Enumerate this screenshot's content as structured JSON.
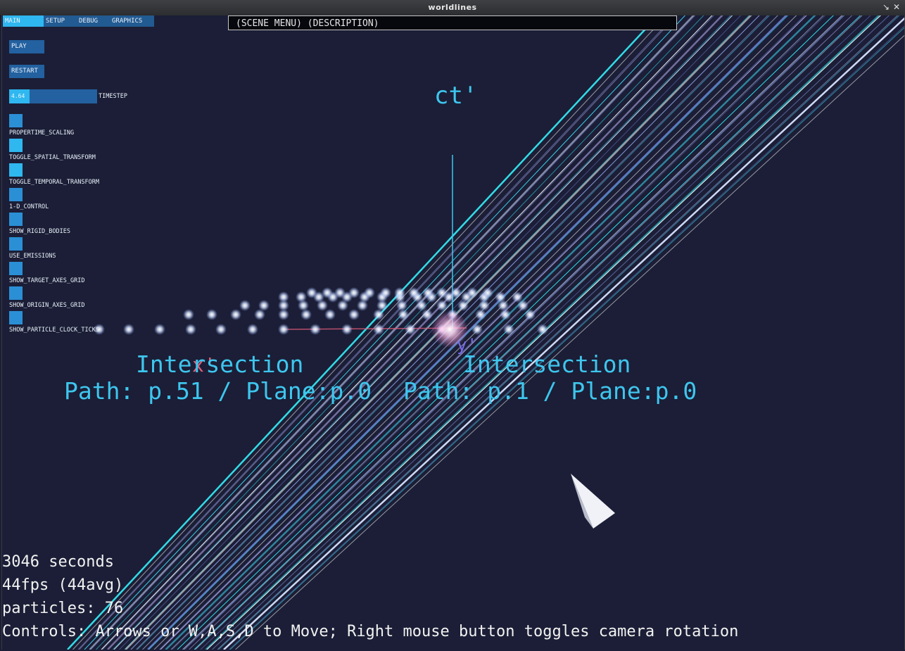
{
  "window": {
    "title": "worldlines",
    "minimize_icon": "minimize-icon",
    "close_icon": "close-icon"
  },
  "scene_bar": {
    "text": "(SCENE MENU) (DESCRIPTION)"
  },
  "tabs": [
    {
      "label": "MAIN",
      "selected": true
    },
    {
      "label": "SETUP",
      "selected": false
    },
    {
      "label": "DEBUG",
      "selected": false
    },
    {
      "label": "GRAPHICS",
      "selected": false
    }
  ],
  "buttons": {
    "play": "PLAY",
    "restart": "RESTART"
  },
  "timestep": {
    "value": "4.64",
    "label": "TIMESTEP",
    "fill_fraction": 0.23
  },
  "toggles": [
    {
      "label": "PROPERTIME_SCALING",
      "on": false
    },
    {
      "label": "TOGGLE_SPATIAL_TRANSFORM",
      "on": true
    },
    {
      "label": "TOGGLE_TEMPORAL_TRANSFORM",
      "on": true
    },
    {
      "label": "1-D_CONTROL",
      "on": false
    },
    {
      "label": "SHOW_RIGID_BODIES",
      "on": false
    },
    {
      "label": "USE_EMISSIONS",
      "on": false
    },
    {
      "label": "SHOW_TARGET_AXES_GRID",
      "on": false
    },
    {
      "label": "SHOW_ORIGIN_AXES_GRID",
      "on": false
    },
    {
      "label": "SHOW_PARTICLE_CLOCK_TICKS",
      "on": false
    }
  ],
  "axes": {
    "ct": "ct'",
    "x": "x'",
    "y": "y'"
  },
  "intersections": [
    {
      "title": "Intersection",
      "detail": "Path: p.51 / Plane:p.0"
    },
    {
      "title": "Intersection",
      "detail": "Path: p.1 / Plane:p.0"
    }
  ],
  "stats": {
    "time": "3046 seconds",
    "fps": "44fps (44avg)",
    "particles": "particles: 76",
    "controls": "Controls: Arrows or W,A,S,D to Move; Right mouse button toggles camera rotation"
  },
  "colors": {
    "background": "#1b1e36",
    "accent": "#2fb7f0",
    "panel_blue": "#2361a0",
    "overlay_text": "#3ec6ee"
  }
}
